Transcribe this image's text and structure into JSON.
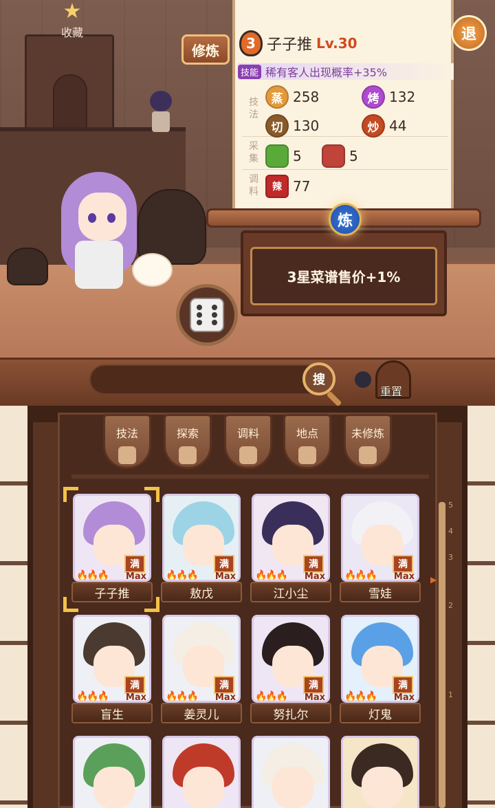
{
  "top": {
    "favorites_label": "收藏",
    "cultivate_label": "修炼",
    "exit_label": "退",
    "refine_label": "炼",
    "bonus_text": "3星菜谱售价+1%"
  },
  "character": {
    "star": "3",
    "name": "子子推",
    "level": "Lv.30",
    "skill_tag": "技能",
    "skill_text": "稀有客人出现概率+35%",
    "sections": {
      "technique": "技法",
      "gather": "采集",
      "seasoning": "调料"
    },
    "stats": [
      {
        "icon": "蒸",
        "value": "258",
        "color": "#e39a3a"
      },
      {
        "icon": "烤",
        "value": "132",
        "color": "#b04ad0"
      },
      {
        "icon": "切",
        "value": "130",
        "color": "#8a5a2a"
      },
      {
        "icon": "炒",
        "value": "44",
        "color": "#c34a22"
      }
    ],
    "gather": [
      {
        "icon": "vegetable-icon",
        "value": "5",
        "color": "#5aaa3a"
      },
      {
        "icon": "meat-icon",
        "value": "5",
        "color": "#c0443a"
      }
    ],
    "seasoning": [
      {
        "icon": "辣",
        "value": "77",
        "color": "#c02a2a"
      }
    ]
  },
  "search": {
    "button_label": "搜",
    "reset_label": "重置"
  },
  "filters": [
    "技法",
    "探索",
    "调料",
    "地点",
    "未修炼"
  ],
  "chefs": [
    {
      "name": "子子推",
      "badge": "满",
      "max": "Max",
      "hair": "#b28cd6",
      "bg": "#efe6f5"
    },
    {
      "name": "敖戊",
      "badge": "满",
      "max": "Max",
      "hair": "#9cd4e6",
      "bg": "#e6f0f4"
    },
    {
      "name": "江小尘",
      "badge": "满",
      "max": "Max",
      "hair": "#3a2e5a",
      "bg": "#f1e7f3"
    },
    {
      "name": "雪娃",
      "badge": "满",
      "max": "Max",
      "hair": "#f1f1f6",
      "bg": "#ece7f5"
    },
    {
      "name": "盲生",
      "badge": "满",
      "max": "Max",
      "hair": "#4a3a30",
      "bg": "#eef0f6"
    },
    {
      "name": "姜灵儿",
      "badge": "满",
      "max": "Max",
      "hair": "#f4eee4",
      "bg": "#eef0f6"
    },
    {
      "name": "努扎尔",
      "badge": "满",
      "max": "Max",
      "hair": "#2a1e1e",
      "bg": "#efe6f5"
    },
    {
      "name": "灯鬼",
      "badge": "满",
      "max": "Max",
      "hair": "#5aa0e6",
      "bg": "#e4f0fb"
    },
    {
      "name": "",
      "badge": "",
      "max": "",
      "hair": "#5aa05a",
      "bg": "#eef0f6"
    },
    {
      "name": "",
      "badge": "",
      "max": "",
      "hair": "#c03a2a",
      "bg": "#efe6f5"
    },
    {
      "name": "",
      "badge": "",
      "max": "",
      "hair": "#f4eee4",
      "bg": "#eef0f6"
    },
    {
      "name": "",
      "badge": "",
      "max": "",
      "hair": "#3a2a22",
      "bg": "#f6e6c8"
    }
  ],
  "scroll_ticks": [
    "5",
    "4",
    "3",
    "2",
    "1"
  ]
}
